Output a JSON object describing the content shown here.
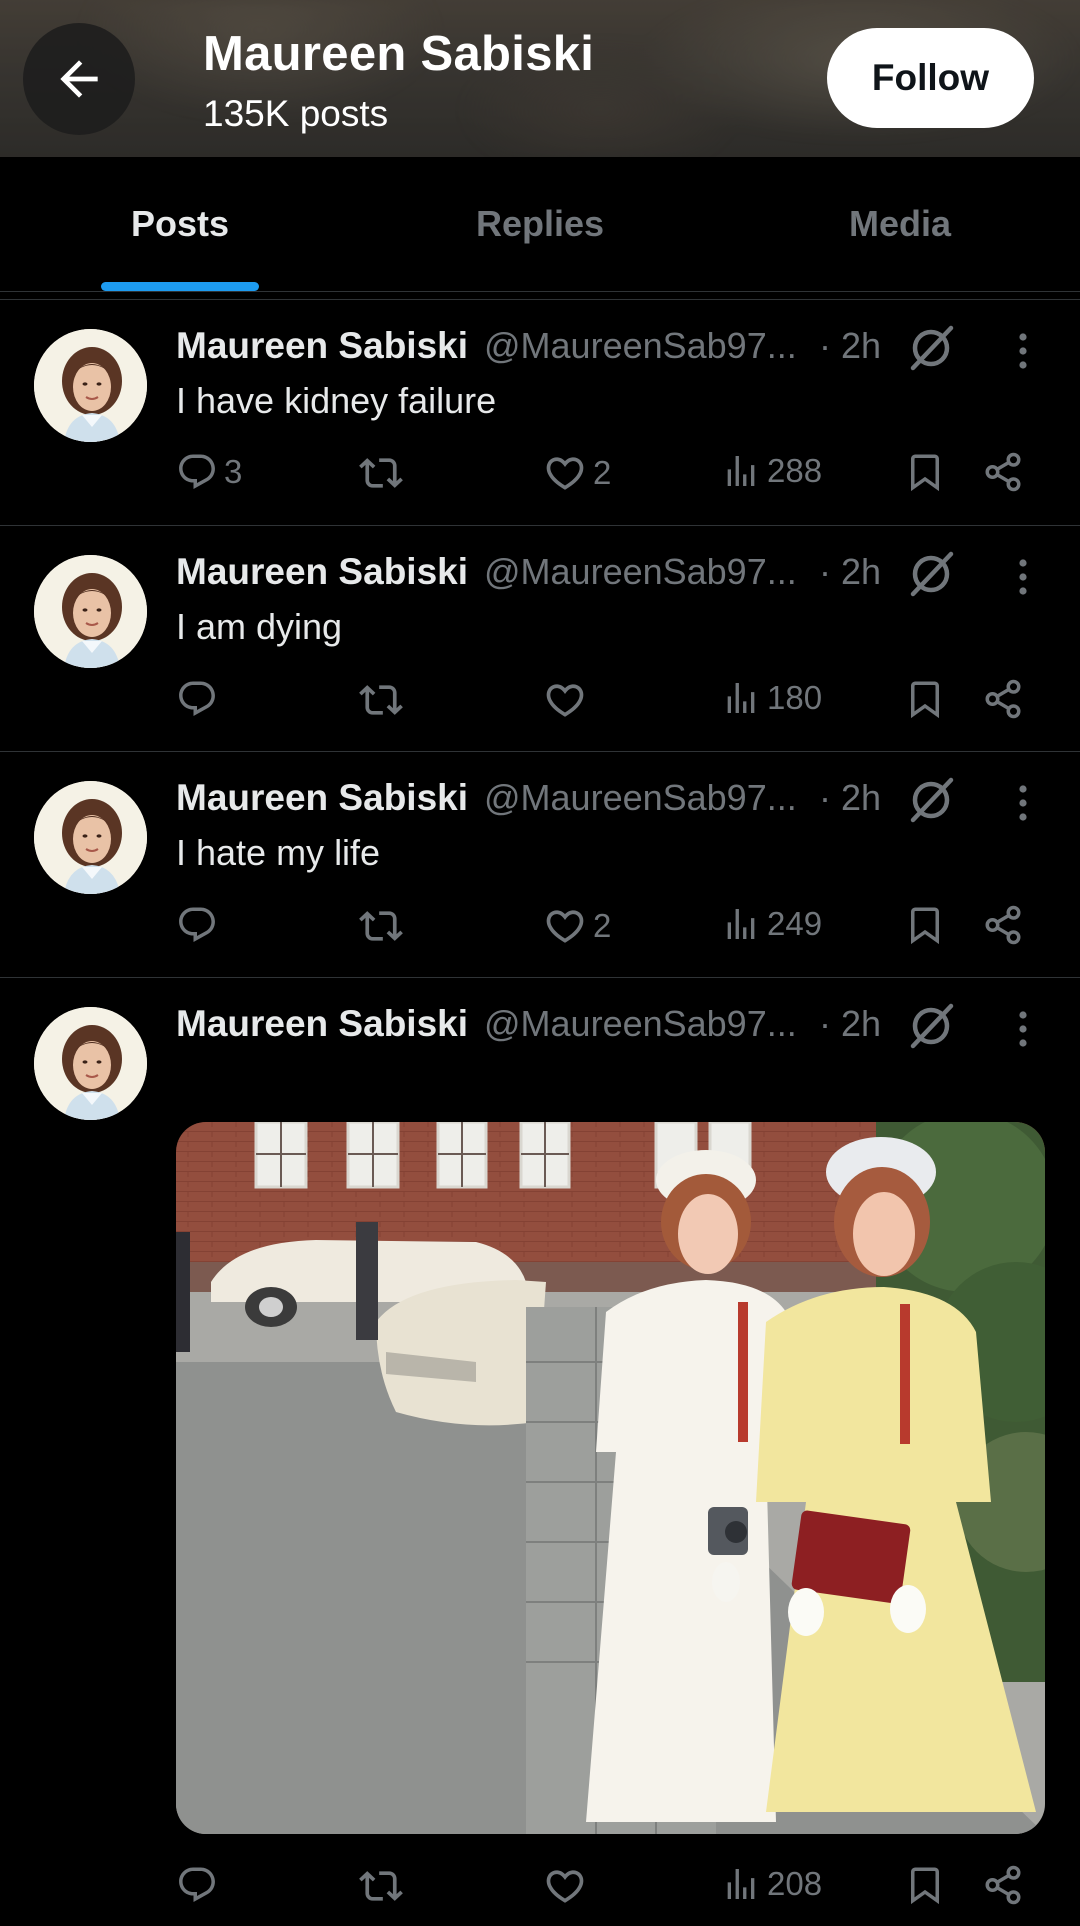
{
  "header": {
    "profile_name": "Maureen Sabiski",
    "post_count": "135K posts",
    "follow_label": "Follow",
    "back_icon": "arrow-left-icon"
  },
  "tabs": [
    {
      "label": "Posts",
      "active": true
    },
    {
      "label": "Replies",
      "active": false
    },
    {
      "label": "Media",
      "active": false
    }
  ],
  "posts": [
    {
      "name": "Maureen Sabiski",
      "handle": "@MaureenSab97...",
      "time": "· 2h",
      "text": "I have kidney failure",
      "replies": "3",
      "reposts": "",
      "likes": "2",
      "views": "288"
    },
    {
      "name": "Maureen Sabiski",
      "handle": "@MaureenSab97...",
      "time": "· 2h",
      "text": "I am dying",
      "replies": "",
      "reposts": "",
      "likes": "",
      "views": "180"
    },
    {
      "name": "Maureen Sabiski",
      "handle": "@MaureenSab97...",
      "time": "· 2h",
      "text": "I hate my life",
      "replies": "",
      "reposts": "",
      "likes": "2",
      "views": "249"
    },
    {
      "name": "Maureen Sabiski",
      "handle": "@MaureenSab97...",
      "time": "· 2h",
      "text": "",
      "replies": "",
      "reposts": "",
      "likes": "",
      "views": "208",
      "has_media": true
    }
  ],
  "colors": {
    "background": "#000000",
    "text": "#e7e9ea",
    "muted": "#71767b",
    "accent": "#1d9bf0",
    "divider": "#2f3336"
  }
}
